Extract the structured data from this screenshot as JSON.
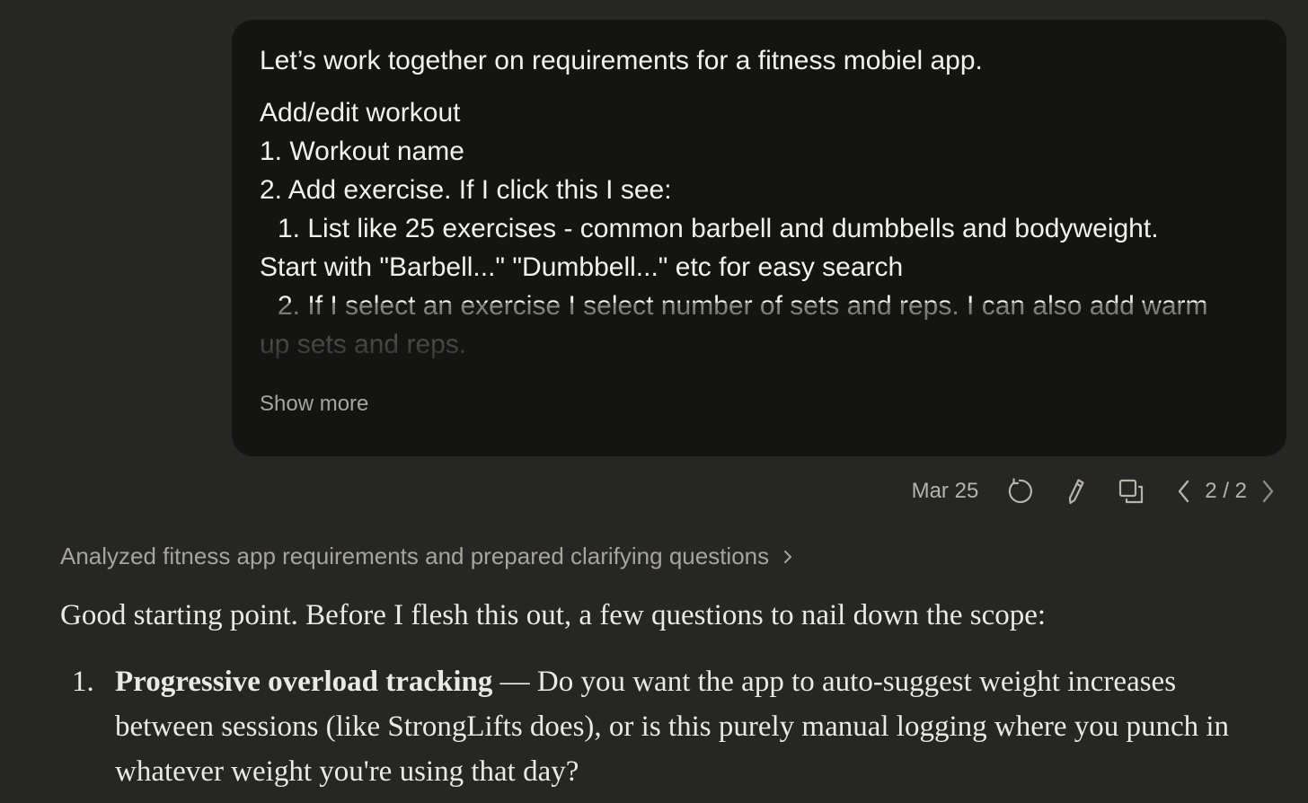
{
  "user_message": {
    "lines": [
      "Let’s work together on requirements for a fitness mobiel app.",
      "Add/edit workout",
      "1. Workout name",
      "2. Add exercise. If I click this I see:",
      "1. List like 25 exercises - common barbell and dumbbells and bodyweight.",
      "Start with \"Barbell...\" \"Dumbbell...\" etc for easy search",
      "2. If I select an exercise I select number of sets and reps. I can also add warm",
      "up sets and reps."
    ],
    "show_more_label": "Show more"
  },
  "message_actions": {
    "date": "Mar 25",
    "version": "2 / 2",
    "icons": [
      "retry-icon",
      "edit-icon",
      "copy-icon",
      "chevron-left-icon",
      "chevron-right-icon"
    ]
  },
  "assistant": {
    "thinking_summary": "Analyzed fitness app requirements and prepared clarifying questions",
    "intro": "Good starting point. Before I flesh this out, a few questions to nail down the scope:",
    "questions": [
      {
        "number": "1.",
        "title": "Progressive overload tracking",
        "body": " — Do you want the app to auto-suggest weight increases between sessions (like StrongLifts does), or is this purely manual logging where you punch in whatever weight you're using that day?"
      }
    ]
  },
  "colors": {
    "background": "#262624",
    "user_bubble": "#141413",
    "muted_text": "#a7a49c",
    "primary_text": "#ebe9e3"
  }
}
